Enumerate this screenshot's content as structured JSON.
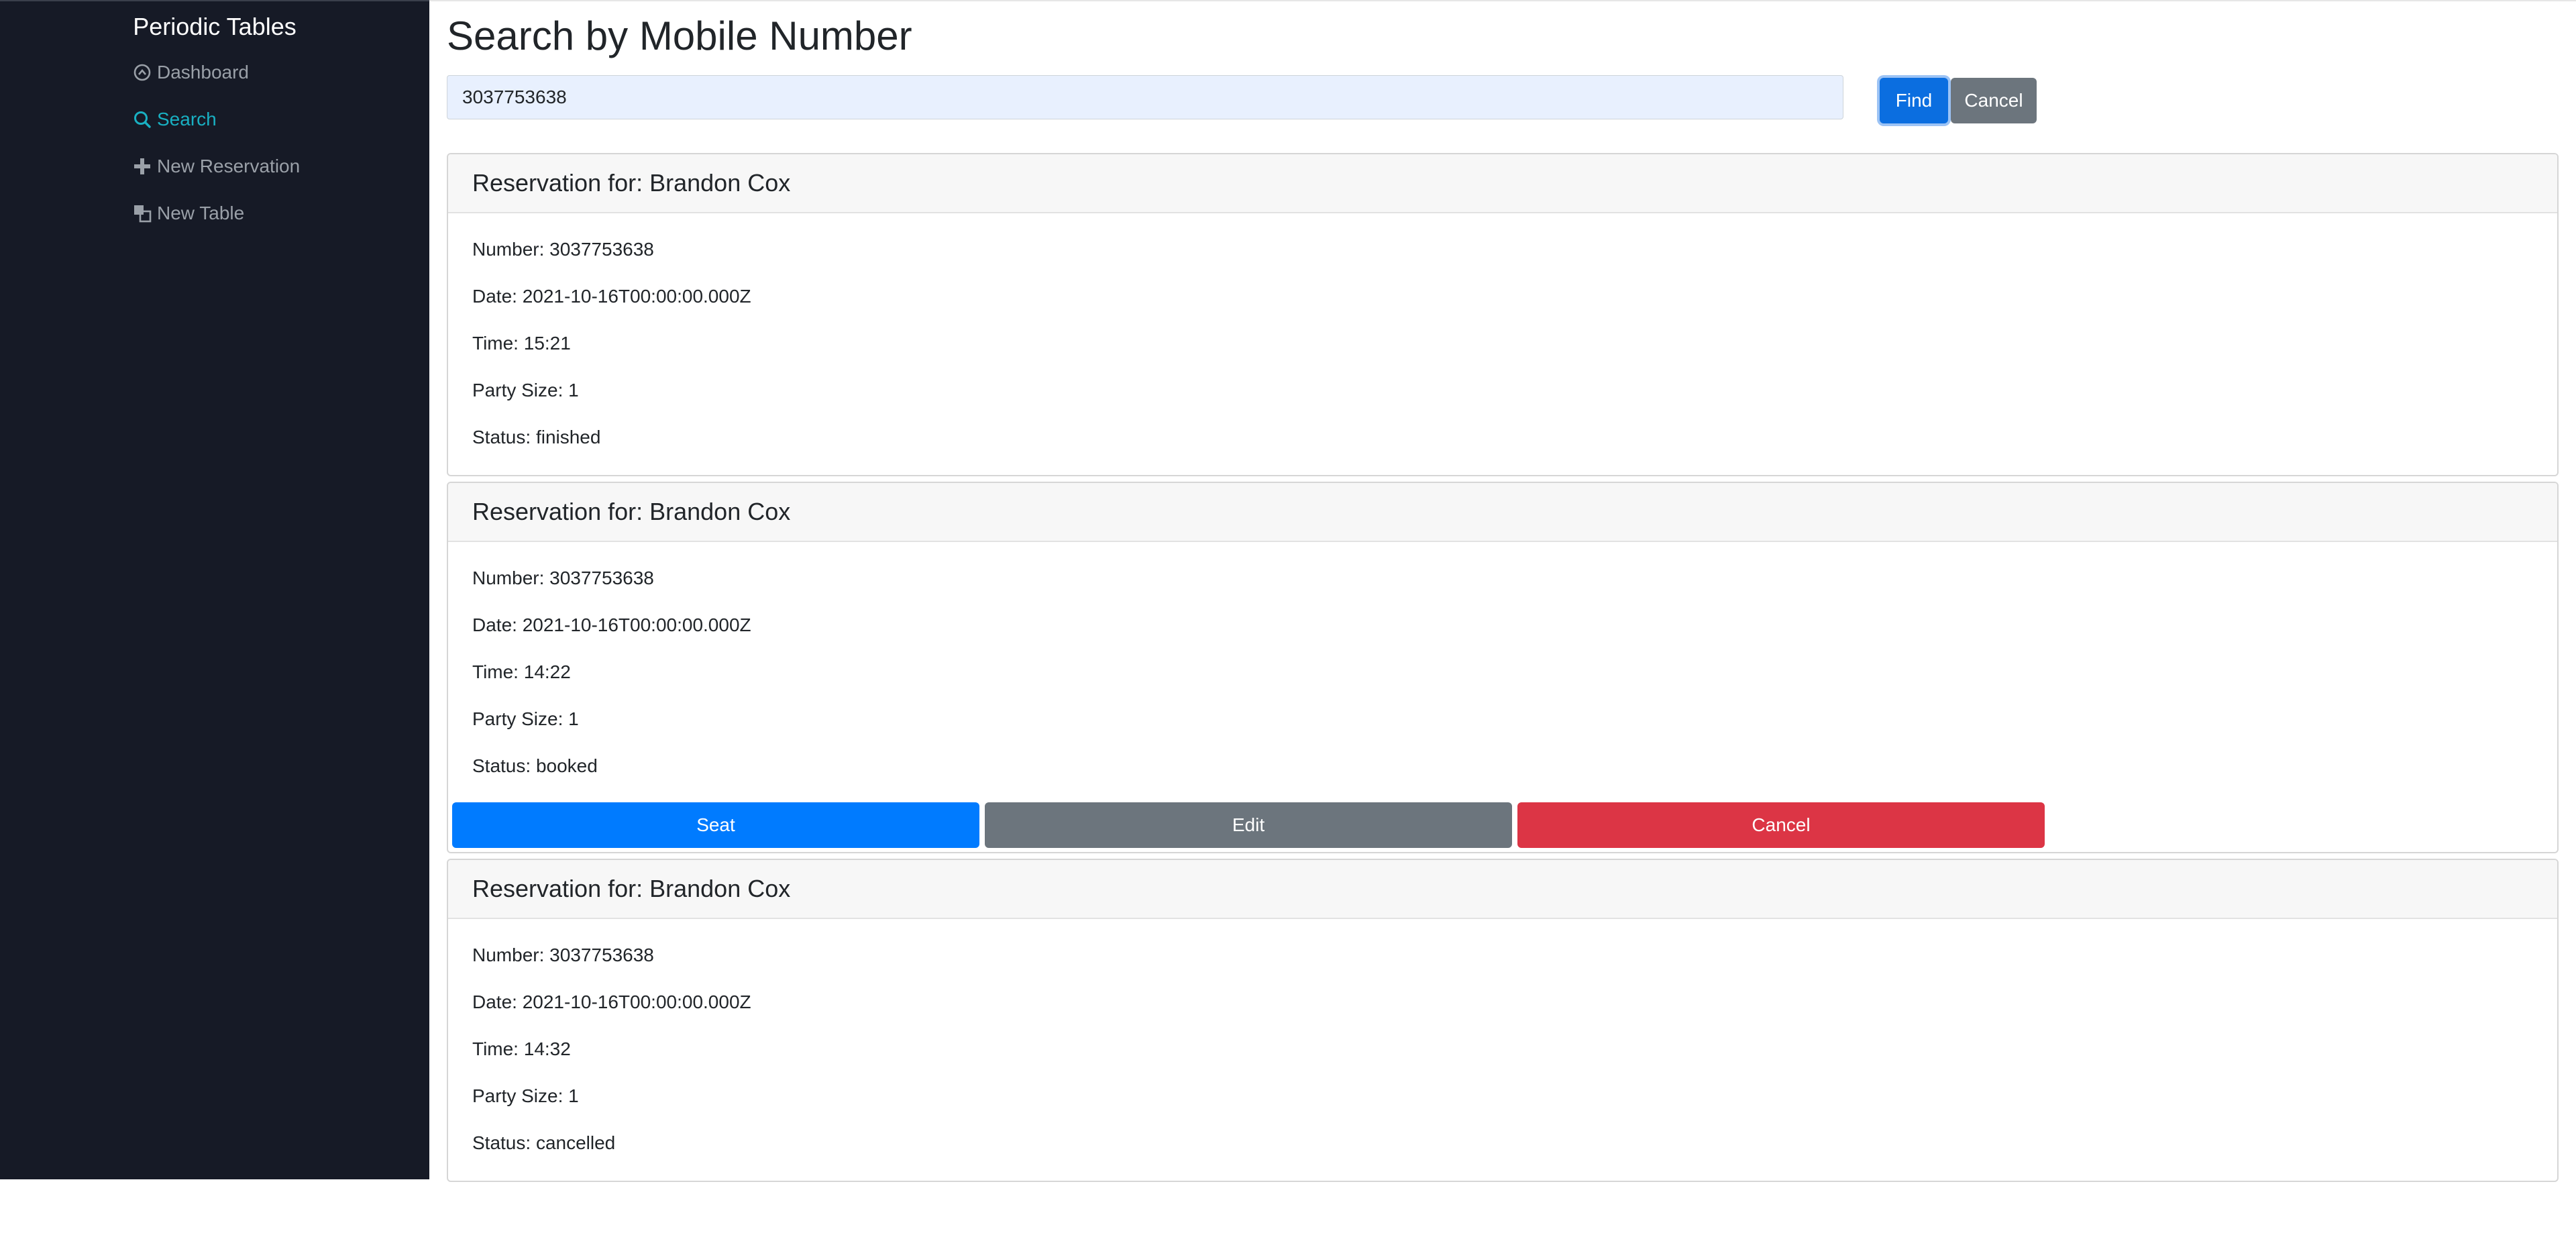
{
  "app": {
    "brand": "Periodic Tables"
  },
  "sidebar": {
    "items": [
      {
        "label": "Dashboard",
        "icon": "dashboard-icon",
        "active": false
      },
      {
        "label": "Search",
        "icon": "search-icon",
        "active": true
      },
      {
        "label": "New Reservation",
        "icon": "plus-icon",
        "active": false
      },
      {
        "label": "New Table",
        "icon": "table-icon",
        "active": false
      }
    ]
  },
  "page": {
    "title": "Search by Mobile Number"
  },
  "search": {
    "value": "3037753638",
    "find_label": "Find",
    "cancel_label": "Cancel"
  },
  "colors": {
    "primary": "#007bff",
    "secondary": "#6c757d",
    "danger": "#dc3545",
    "sidebar_bg": "#161a26",
    "active_nav": "#19b0c2"
  },
  "reservations": [
    {
      "header": "Reservation for: Brandon Cox",
      "number": "Number: 3037753638",
      "date": "Date: 2021-10-16T00:00:00.000Z",
      "time": "Time: 15:21",
      "party_size": "Party Size: 1",
      "status": "Status: finished"
    },
    {
      "header": "Reservation for: Brandon Cox",
      "number": "Number: 3037753638",
      "date": "Date: 2021-10-16T00:00:00.000Z",
      "time": "Time: 14:22",
      "party_size": "Party Size: 1",
      "status": "Status: booked",
      "actions": {
        "seat": "Seat",
        "edit": "Edit",
        "cancel": "Cancel"
      }
    },
    {
      "header": "Reservation for: Brandon Cox",
      "number": "Number: 3037753638",
      "date": "Date: 2021-10-16T00:00:00.000Z",
      "time": "Time: 14:32",
      "party_size": "Party Size: 1",
      "status": "Status: cancelled"
    }
  ]
}
